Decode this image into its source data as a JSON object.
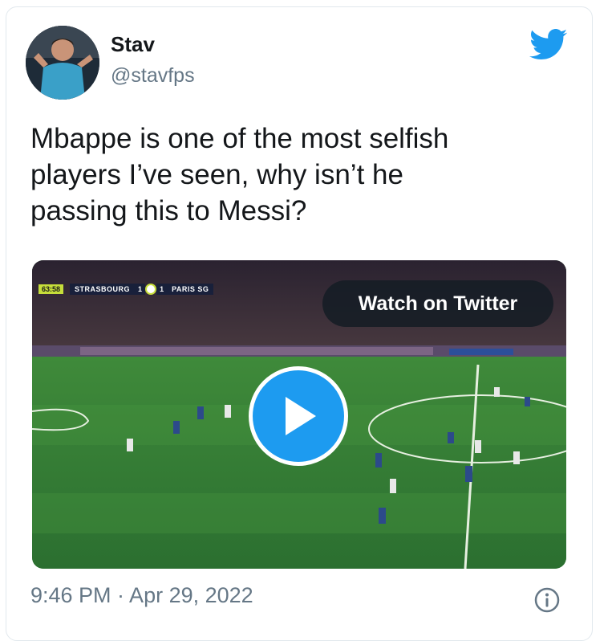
{
  "author": {
    "name": "Stav",
    "handle": "@stavfps",
    "avatar_icon": "player-avatar-image"
  },
  "icons": {
    "brand": "twitter-bird-icon",
    "play": "play-icon",
    "info": "info-icon"
  },
  "tweet": {
    "text_lines": [
      "Mbappe is one of the most selfish",
      "players I’ve seen, why isn’t he",
      "passing this to Messi?"
    ]
  },
  "media": {
    "watch_label": "Watch on Twitter",
    "scoreboard": {
      "time": "63:58",
      "home": "STRASBOURG",
      "home_score": "1",
      "away_score": "1",
      "away": "PARIS SG"
    }
  },
  "footer": {
    "timestamp": "9:46 PM · Apr 29, 2022"
  },
  "colors": {
    "brand_blue": "#1d9bf0",
    "text": "#14171a",
    "secondary": "#657786",
    "pitch": "#2e7a36"
  }
}
